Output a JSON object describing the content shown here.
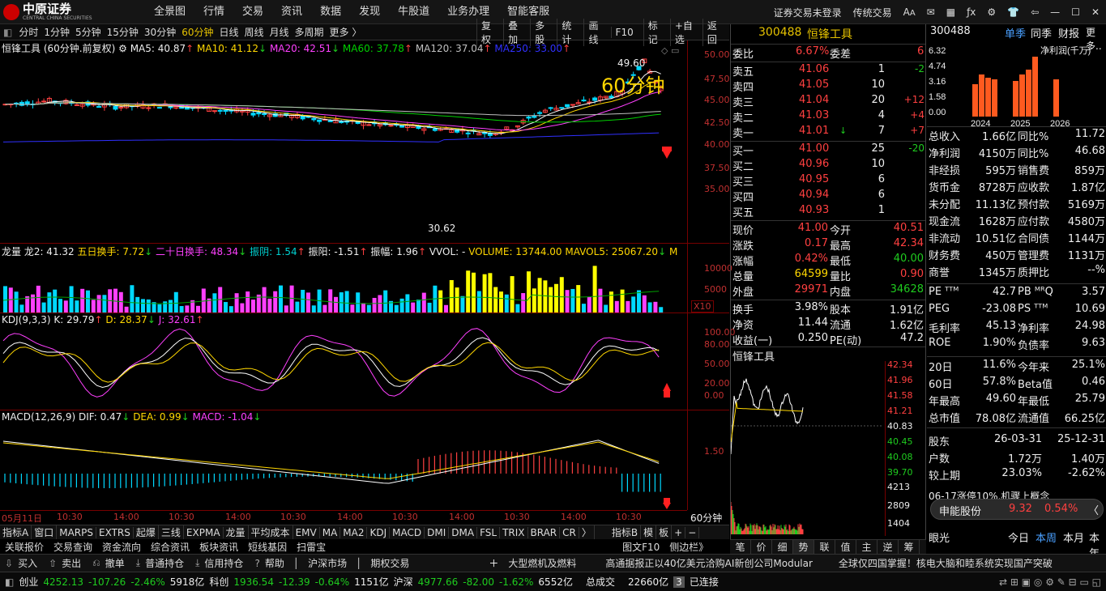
{
  "top": {
    "brand": "中原证券",
    "brand_en": "CENTRAL CHINA SECURITIES",
    "menu": [
      "全景图",
      "行情",
      "交易",
      "资讯",
      "数据",
      "发现",
      "牛股道",
      "业务办理",
      "智能客服"
    ],
    "login": "证券交易未登录",
    "mode": "传统交易"
  },
  "periods": [
    "分时",
    "1分钟",
    "5分钟",
    "15分钟",
    "30分钟",
    "60分钟",
    "日线",
    "周线",
    "月线",
    "多周期",
    "更多 〉"
  ],
  "period_active": "60分钟",
  "tools": [
    "复权",
    "叠加",
    "多股",
    "统计",
    "画线",
    "F10",
    "标记",
    "+自选",
    "返回"
  ],
  "main_legend": {
    "name": "恒锋工具 (60分钟.前复权)",
    "ma5": "MA5: 40.87",
    "ma10": "MA10: 41.12",
    "ma20": "MA20: 42.51",
    "ma60": "MA60: 37.78",
    "ma120": "MA120: 37.04",
    "ma250": "MA250: 33.00"
  },
  "overlay_label": "60分钟",
  "price_high": "49.60",
  "price_low": "30.62",
  "yaxis_main": [
    "50.00",
    "47.50",
    "45.00",
    "42.50",
    "40.00",
    "37.50",
    "35.00"
  ],
  "vol_legend": {
    "a": "龙量 龙2: 41.32",
    "b": "五日换手: 7.72",
    "c": "二十日换手: 48.34",
    "d": "振阴: 1.54",
    "e": "振阳: -1.51",
    "f": "振幅: 1.96",
    "g": "VVOL: -",
    "h": "VOLUME: 13744.00",
    "i": "MAVOL5: 25067.20",
    "j": "M"
  },
  "yaxis_vol": [
    "10000",
    "5000"
  ],
  "vol_unit": "X10",
  "kdj_legend": {
    "a": "KDJ(9,3,3)",
    "k": "K: 29.79",
    "d": "D: 28.37",
    "j": "J: 32.61"
  },
  "yaxis_kdj": [
    "100.00",
    "80.00",
    "50.00",
    "20.00",
    "0.00"
  ],
  "macd_legend": {
    "a": "MACD(12,26,9)",
    "dif": "DIF: 0.47",
    "dea": "DEA: 0.99",
    "macd": "MACD: -1.04"
  },
  "yaxis_macd": [
    "1.50"
  ],
  "xaxis": [
    "05月11日",
    "10:30",
    "14:00",
    "10:30",
    "14:00",
    "10:30",
    "14:00",
    "10:30",
    "14:00",
    "10:30",
    "14:00",
    "10:30"
  ],
  "period_corner": "60分钟",
  "indicator_tabs": [
    "指标A",
    "窗口",
    "MARPS",
    "EXTRS",
    "起爆",
    "三线",
    "EXPMA",
    "龙量",
    "平均成本",
    "EMV",
    "MA",
    "MA2",
    "KDJ",
    "MACD",
    "DMI",
    "DMA",
    "FSL",
    "TRIX",
    "BRAR",
    "CR",
    "〉",
    "指标B",
    "模",
    "板",
    "+",
    "−"
  ],
  "info_tabs": [
    "关联报价",
    "交易查询",
    "资金流向",
    "综合资讯",
    "板块资讯",
    "短线基因",
    "扫雷宝",
    "图文F10",
    "侧边栏》"
  ],
  "stock": {
    "code": "300488",
    "name": "恒锋工具",
    "webi": "委比",
    "webi_v": "6.67%",
    "wc": "委差",
    "wc_v": "6"
  },
  "asks": [
    {
      "l": "卖五",
      "p": "41.06",
      "v": "1",
      "c": "-2"
    },
    {
      "l": "卖四",
      "p": "41.05",
      "v": "10",
      "c": ""
    },
    {
      "l": "卖三",
      "p": "41.04",
      "v": "20",
      "c": "+12"
    },
    {
      "l": "卖二",
      "p": "41.03",
      "v": "4",
      "c": "+4"
    },
    {
      "l": "卖一",
      "p": "41.01",
      "v": "7",
      "c": "+7"
    }
  ],
  "bids": [
    {
      "l": "买一",
      "p": "41.00",
      "v": "25",
      "c": "-20"
    },
    {
      "l": "买二",
      "p": "40.96",
      "v": "10",
      "c": ""
    },
    {
      "l": "买三",
      "p": "40.95",
      "v": "6",
      "c": ""
    },
    {
      "l": "买四",
      "p": "40.94",
      "v": "6",
      "c": ""
    },
    {
      "l": "买五",
      "p": "40.93",
      "v": "1",
      "c": ""
    }
  ],
  "quote": [
    [
      "现价",
      "41.00",
      "今开",
      "40.51"
    ],
    [
      "涨跌",
      "0.17",
      "最高",
      "42.34"
    ],
    [
      "涨幅",
      "0.42%",
      "最低",
      "40.00"
    ],
    [
      "总量",
      "64599",
      "量比",
      "0.90"
    ],
    [
      "外盘",
      "29971",
      "内盘",
      "34628"
    ]
  ],
  "quote2": [
    [
      "换手",
      "3.98%",
      "股本",
      "1.91亿"
    ],
    [
      "净资",
      "11.44",
      "流通",
      "1.62亿"
    ],
    [
      "收益(一)",
      "0.250",
      "PE(动)",
      "47.2"
    ]
  ],
  "mini": {
    "title": "恒锋工具",
    "y": [
      "42.34",
      "41.96",
      "41.58",
      "41.21",
      "40.83",
      "40.45",
      "40.08",
      "39.70",
      "4213",
      "2809",
      "1404"
    ]
  },
  "mid_tabs": [
    "笔",
    "价",
    "细",
    "势",
    "联",
    "值",
    "主",
    "逆",
    "筹"
  ],
  "fin": {
    "code": "300488",
    "tabs": [
      "单季",
      "同季",
      "财报",
      "更多.."
    ],
    "chart_title": "净利润(千万)",
    "y": [
      "6.32",
      "4.74",
      "3.16",
      "1.58",
      "0.00"
    ],
    "years": [
      "2024",
      "2025",
      "2026"
    ]
  },
  "fin_rows": [
    [
      "总收入",
      "1.66亿",
      "同比%",
      "11.72"
    ],
    [
      "净利润",
      "4150万",
      "同比%",
      "46.68"
    ],
    [
      "非经损",
      "595万",
      "销售费",
      "859万"
    ],
    [
      "货币金",
      "8728万",
      "应收款",
      "1.87亿"
    ],
    [
      "未分配",
      "11.13亿",
      "预付款",
      "5169万"
    ],
    [
      "现金流",
      "1628万",
      "应付款",
      "4580万"
    ],
    [
      "非流动",
      "10.51亿",
      "合同债",
      "1144万"
    ],
    [
      "财务费",
      "450万",
      "管理费",
      "1131万"
    ],
    [
      "商誉",
      "1345万",
      "质押比",
      "--%"
    ]
  ],
  "val_rows": [
    [
      "PE ᵀᵀᴹ",
      "42.7",
      "PB ᴹᴿQ",
      "3.57"
    ],
    [
      "PEG",
      "-23.08",
      "PS ᵀᵀᴹ",
      "10.69"
    ],
    [
      "毛利率",
      "45.13",
      "净利率",
      "24.98"
    ],
    [
      "ROE",
      "1.90%",
      "负债率",
      "9.63"
    ]
  ],
  "perf_rows": [
    [
      "20日",
      "11.6%",
      "今年来",
      "25.1%"
    ],
    [
      "60日",
      "57.8%",
      "Beta值",
      "0.46"
    ],
    [
      "年最高",
      "49.60",
      "年最低",
      "25.79"
    ],
    [
      "总市值",
      "78.08亿",
      "流通值",
      "66.25亿"
    ]
  ],
  "holder_rows": [
    [
      "股东",
      "26-03-31",
      "25-12-31"
    ],
    [
      "户数",
      "1.72万",
      "1.40万"
    ],
    [
      "较上期",
      "23.03%",
      "-2.62%"
    ]
  ],
  "notice": "06-17涨停10%,机骤上概念",
  "popup": {
    "name": "申能股份",
    "price": "9.32",
    "chg": "0.54%"
  },
  "rank": {
    "label": "眼光",
    "tabs": [
      "今日",
      "本周",
      "本月",
      "本年"
    ],
    "active": "本周"
  },
  "bottom": {
    "buy": "买入",
    "sell": "卖出",
    "cancel": "撤单",
    "hold": "普通持仓",
    "credit": "信用持仓",
    "help": "帮助",
    "market": "沪深市场",
    "opt": "期权交易",
    "sector": "大型燃机及燃料",
    "news1": "高通据报正以40亿美元洽购AI新创公司Modular",
    "news2": "全球仅四国掌握！核电大脑和睦系统实现国产突破"
  },
  "status": {
    "cy": "创业",
    "cy_v": "4252.13",
    "cy_c": "-107.26",
    "cy_p": "-2.46%",
    "cy_a": "5918亿",
    "kc": "科创",
    "kc_v": "1936.54",
    "kc_c": "-12.39",
    "kc_p": "-0.64%",
    "kc_a": "1151亿",
    "hs": "沪深",
    "hs_v": "4977.66",
    "hs_c": "-82.00",
    "hs_p": "-1.62%",
    "hs_a": "6552亿",
    "tot": "总成交",
    "tot_v": "22660亿",
    "conn": "已连接",
    "conn_n": "3"
  },
  "colors": {
    "up": "#ff4040",
    "down": "#1fcc1f",
    "ma5": "#ffffff",
    "ma10": "#ffd700",
    "ma20": "#ff40ff",
    "ma60": "#00d000",
    "ma120": "#c0c0c0",
    "ma250": "#3030ff",
    "axis": "#700000"
  }
}
